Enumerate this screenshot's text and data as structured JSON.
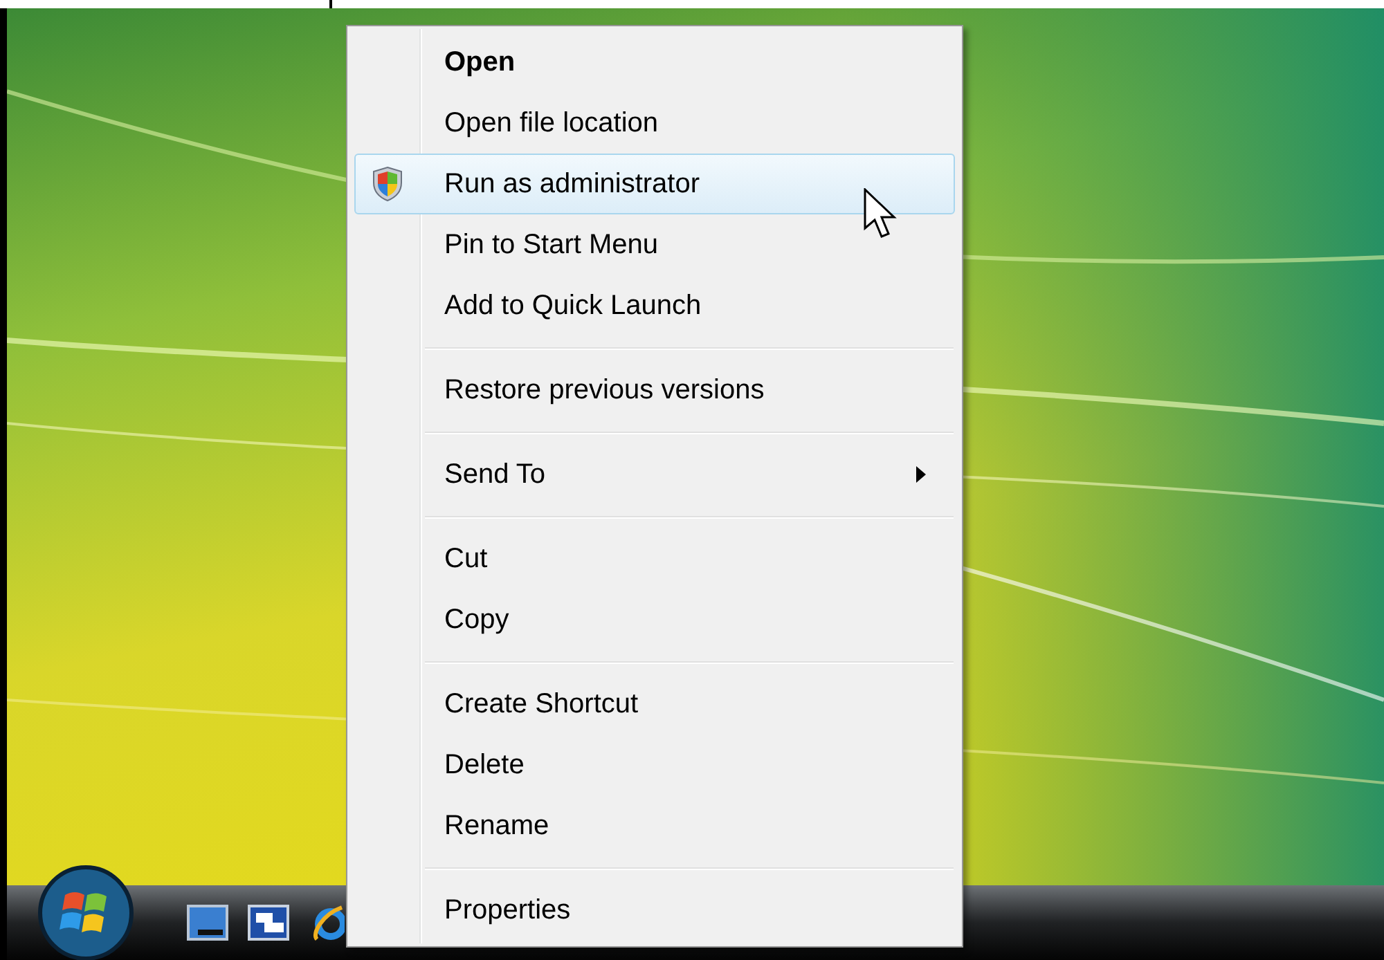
{
  "context_menu": {
    "groups": [
      {
        "items": [
          {
            "label": "Open",
            "kind": "plain",
            "default": true,
            "selected": false,
            "submenu": false
          },
          {
            "label": "Open file location",
            "kind": "plain",
            "default": false,
            "selected": false,
            "submenu": false
          },
          {
            "label": "Run as administrator",
            "kind": "shield",
            "default": false,
            "selected": true,
            "submenu": false
          },
          {
            "label": "Pin to Start Menu",
            "kind": "plain",
            "default": false,
            "selected": false,
            "submenu": false
          },
          {
            "label": "Add to Quick Launch",
            "kind": "plain",
            "default": false,
            "selected": false,
            "submenu": false
          }
        ]
      },
      {
        "items": [
          {
            "label": "Restore previous versions",
            "kind": "plain",
            "default": false,
            "selected": false,
            "submenu": false
          }
        ]
      },
      {
        "items": [
          {
            "label": "Send To",
            "kind": "plain",
            "default": false,
            "selected": false,
            "submenu": true
          }
        ]
      },
      {
        "items": [
          {
            "label": "Cut",
            "kind": "plain",
            "default": false,
            "selected": false,
            "submenu": false
          },
          {
            "label": "Copy",
            "kind": "plain",
            "default": false,
            "selected": false,
            "submenu": false
          }
        ]
      },
      {
        "items": [
          {
            "label": "Create Shortcut",
            "kind": "plain",
            "default": false,
            "selected": false,
            "submenu": false
          },
          {
            "label": "Delete",
            "kind": "plain",
            "default": false,
            "selected": false,
            "submenu": false
          },
          {
            "label": "Rename",
            "kind": "plain",
            "default": false,
            "selected": false,
            "submenu": false
          }
        ]
      },
      {
        "items": [
          {
            "label": "Properties",
            "kind": "plain",
            "default": false,
            "selected": false,
            "submenu": false
          }
        ]
      }
    ]
  }
}
